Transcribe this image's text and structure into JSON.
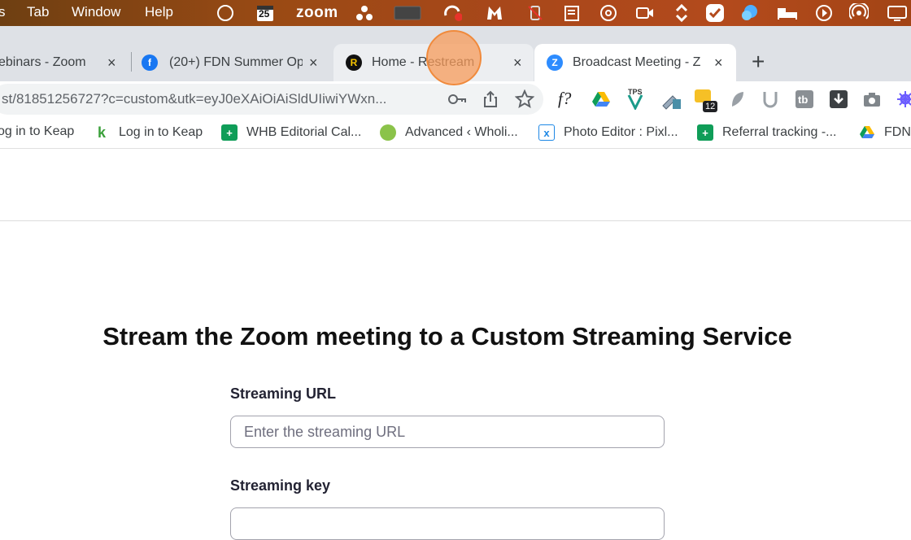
{
  "menubar": {
    "items": [
      "s",
      "Tab",
      "Window",
      "Help"
    ],
    "calendar_day": "25",
    "zoom_text": "zoom",
    "badge_count": "12"
  },
  "tabs": [
    {
      "title": "ebinars - Zoom",
      "close": "×"
    },
    {
      "title": "(20+) FDN Summer Op",
      "close": "×"
    },
    {
      "title": "Home - Restream",
      "close": "×"
    },
    {
      "title": "Broadcast Meeting - Z",
      "close": "×"
    }
  ],
  "new_tab": "+",
  "address_bar": {
    "url": "st/81851256727?c=custom&utk=eyJ0eXAiOiAiSldUIiwiYWxn..."
  },
  "extensions": {
    "fquery": "f?",
    "tps": "TPS"
  },
  "bookmarks": [
    {
      "label": "og in to Keap"
    },
    {
      "label": "Log in to Keap"
    },
    {
      "label": "WHB Editorial Cal..."
    },
    {
      "label": "Advanced ‹ Wholi..."
    },
    {
      "label": "Photo Editor : Pixl..."
    },
    {
      "label": "Referral tracking -..."
    },
    {
      "label": "FDN"
    }
  ],
  "page": {
    "heading": "Stream the Zoom meeting to a Custom Streaming Service",
    "streaming_url_label": "Streaming URL",
    "streaming_url_placeholder": "Enter the streaming URL",
    "streaming_url_value": "",
    "streaming_key_label": "Streaming key"
  },
  "colors": {
    "zoom_blue": "#2d8cff",
    "accent_orange": "#f08a3c"
  }
}
